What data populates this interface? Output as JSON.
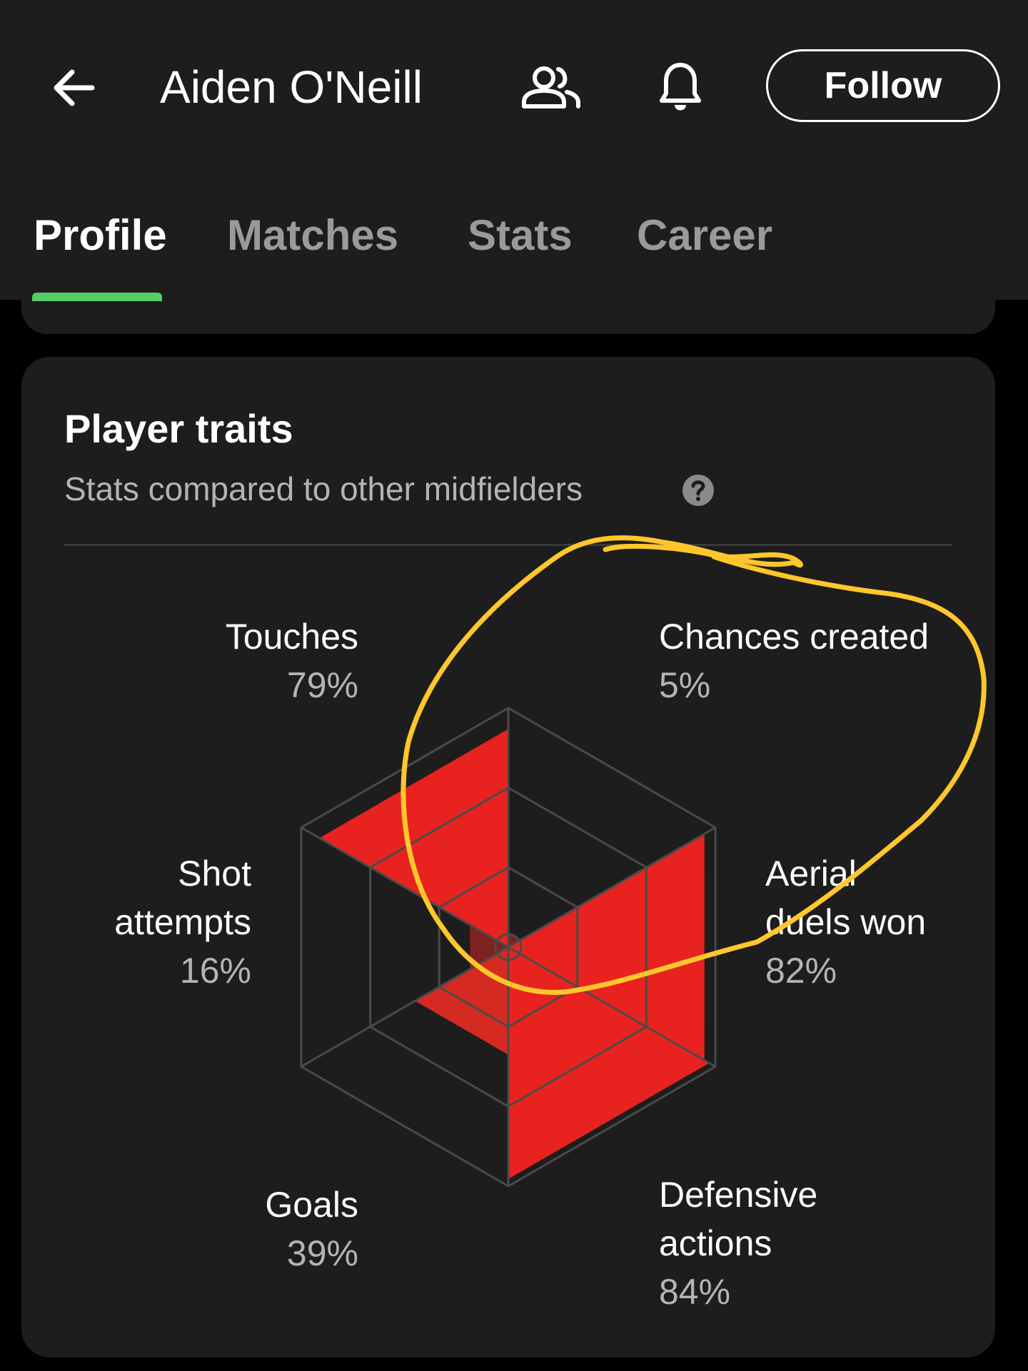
{
  "header": {
    "title": "Aiden O'Neill",
    "back_icon": "arrow-left-icon",
    "squad_icon": "people-icon",
    "notify_icon": "bell-icon",
    "follow_label": "Follow"
  },
  "tabs": [
    {
      "label": "Profile",
      "active": true
    },
    {
      "label": "Matches",
      "active": false
    },
    {
      "label": "Stats",
      "active": false
    },
    {
      "label": "Career",
      "active": false
    }
  ],
  "traits_card": {
    "title": "Player traits",
    "subtitle": "Stats compared to other midfielders",
    "help_icon": "question-circle-icon"
  },
  "chart_data": {
    "type": "radar",
    "title": "Player traits",
    "subtitle": "Stats compared to other midfielders",
    "axes": [
      {
        "name_lines": [
          "Chances created"
        ],
        "value": "5%",
        "pct": 5
      },
      {
        "name_lines": [
          "Aerial",
          "duels won"
        ],
        "value": "82%",
        "pct": 82
      },
      {
        "name_lines": [
          "Defensive",
          "actions"
        ],
        "value": "84%",
        "pct": 84
      },
      {
        "name_lines": [
          "Goals"
        ],
        "value": "39%",
        "pct": 39
      },
      {
        "name_lines": [
          "Shot",
          "attempts"
        ],
        "value": "16%",
        "pct": 16
      },
      {
        "name_lines": [
          "Touches"
        ],
        "value": "79%",
        "pct": 79
      }
    ],
    "grid_rings": 3,
    "fill_colors": {
      "high": "#e8231f",
      "mid": "#d42a22",
      "low": "#7e2220"
    },
    "grid_color": "#4a4a4a"
  },
  "annotation": {
    "color": "#ffc72c"
  },
  "colors": {
    "background": "#000000",
    "surface": "#1d1d1d",
    "accent": "#55cc66",
    "muted_text": "#b4b4b4"
  }
}
